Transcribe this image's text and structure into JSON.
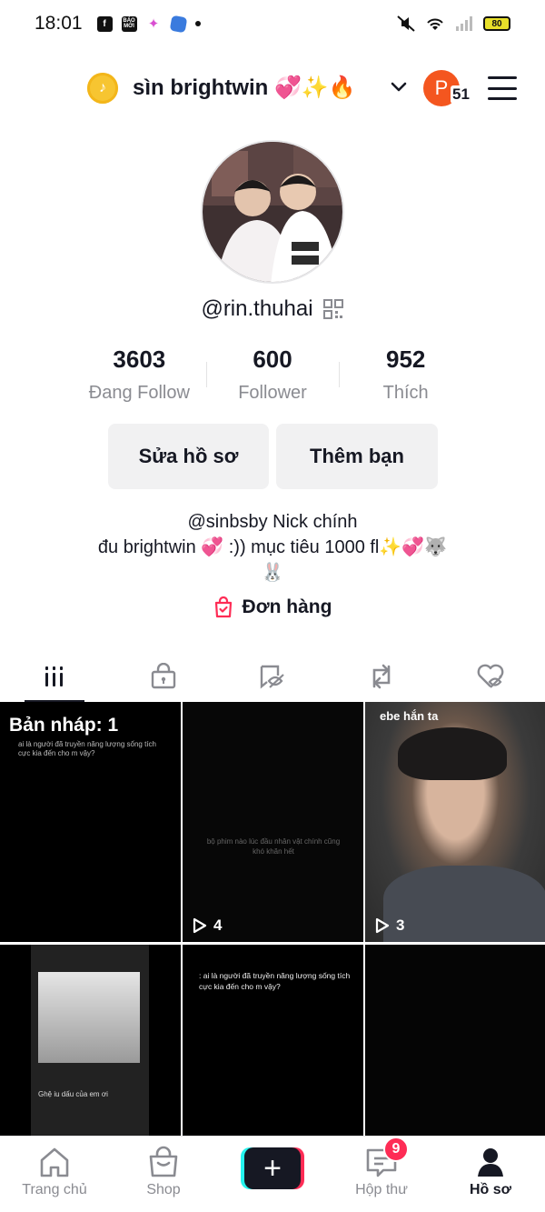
{
  "status_bar": {
    "time": "18:01",
    "battery": "80",
    "app_icons": [
      "facebook-icon",
      "baomoi-icon",
      "gem-icon",
      "cube-icon",
      "dot-icon"
    ],
    "baomoi_label": "BÁO MỚI"
  },
  "header": {
    "username": "sìn brightwin 💞✨🔥",
    "account_initial": "P",
    "notification_count": "51"
  },
  "profile": {
    "handle": "@rin.thuhai",
    "stats": [
      {
        "value": "3603",
        "label": "Đang Follow"
      },
      {
        "value": "600",
        "label": "Follower"
      },
      {
        "value": "952",
        "label": "Thích"
      }
    ],
    "edit_label": "Sửa hồ sơ",
    "add_friend_label": "Thêm bạn",
    "bio_line1": "@sinbsby Nick chính",
    "bio_line2": "đu  brightwin 💞 :)) mục tiêu  1000 fl✨💞🐺",
    "bio_line3": "🐰",
    "orders_label": "Đơn hàng"
  },
  "tabs": [
    "videos-tab",
    "private-tab",
    "hidden-tab",
    "repost-tab",
    "liked-tab"
  ],
  "grid": {
    "draft_label": "Bản nháp: 1",
    "draft_sub": "ai là người đã truyền năng lượng sống tích cực kia đến cho m vậy?",
    "cell2_caption": "bộ phim nào lúc đầu nhân vật chính cũng khó khăn hết",
    "cell2_views": "4",
    "cell3_overlay": "ebe hắn ta",
    "cell3_views": "3",
    "cell4_song": "Ghệ iu dấu của em ơi",
    "cell5_caption": ": ai là người đã truyền năng lượng\nsống tích cực kia đến cho m vậy?"
  },
  "bottom_nav": {
    "home": "Trang chủ",
    "shop": "Shop",
    "inbox": "Hộp thư",
    "inbox_badge": "9",
    "profile": "Hồ sơ"
  },
  "colors": {
    "accent_red": "#fe2c55",
    "accent_cyan": "#25f4ee",
    "text_primary": "#161823",
    "text_secondary": "#8a8b91"
  }
}
